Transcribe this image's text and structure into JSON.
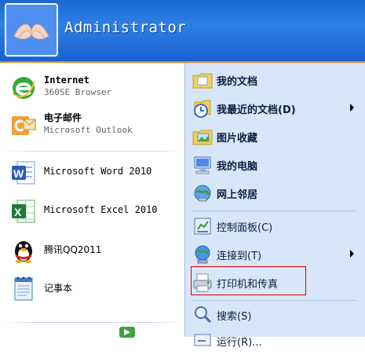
{
  "user": {
    "name": "Administrator",
    "avatar_icon": "butterfly-avatar-icon"
  },
  "pinned": [
    {
      "title": "Internet",
      "subtitle": "360SE Browser",
      "icon": "browser-e-icon"
    },
    {
      "title": "电子邮件",
      "subtitle": "Microsoft Outlook",
      "icon": "outlook-icon"
    }
  ],
  "recent": [
    {
      "label": "Microsoft Word 2010",
      "icon": "word-icon"
    },
    {
      "label": "Microsoft Excel 2010",
      "icon": "excel-icon"
    },
    {
      "label": "腾讯QQ2011",
      "icon": "qq-penguin-icon"
    },
    {
      "label": "记事本",
      "icon": "notepad-icon"
    }
  ],
  "places": [
    {
      "label": "我的文档",
      "icon": "documents-folder-icon",
      "bold": true
    },
    {
      "label": "我最近的文档(D)",
      "icon": "recent-docs-icon",
      "bold": true,
      "submenu": true
    },
    {
      "label": "图片收藏",
      "icon": "pictures-folder-icon",
      "bold": true
    },
    {
      "label": "我的电脑",
      "icon": "my-computer-icon",
      "bold": true
    },
    {
      "label": "网上邻居",
      "icon": "network-icon",
      "bold": true
    },
    {
      "label": "控制面板(C)",
      "icon": "control-panel-icon",
      "bold": false
    },
    {
      "label": "连接到(T)",
      "icon": "connect-to-icon",
      "bold": false,
      "submenu": true
    },
    {
      "label": "打印机和传真",
      "icon": "printer-icon",
      "bold": false,
      "highlighted": true
    },
    {
      "label": "搜索(S)",
      "icon": "search-icon",
      "bold": false
    },
    {
      "label": "运行(R)...",
      "icon": "run-icon",
      "bold": false
    }
  ],
  "colors": {
    "header_blue": "#1b68d4",
    "right_panel": "#d7e6f8",
    "highlight_box": "#d80000"
  }
}
